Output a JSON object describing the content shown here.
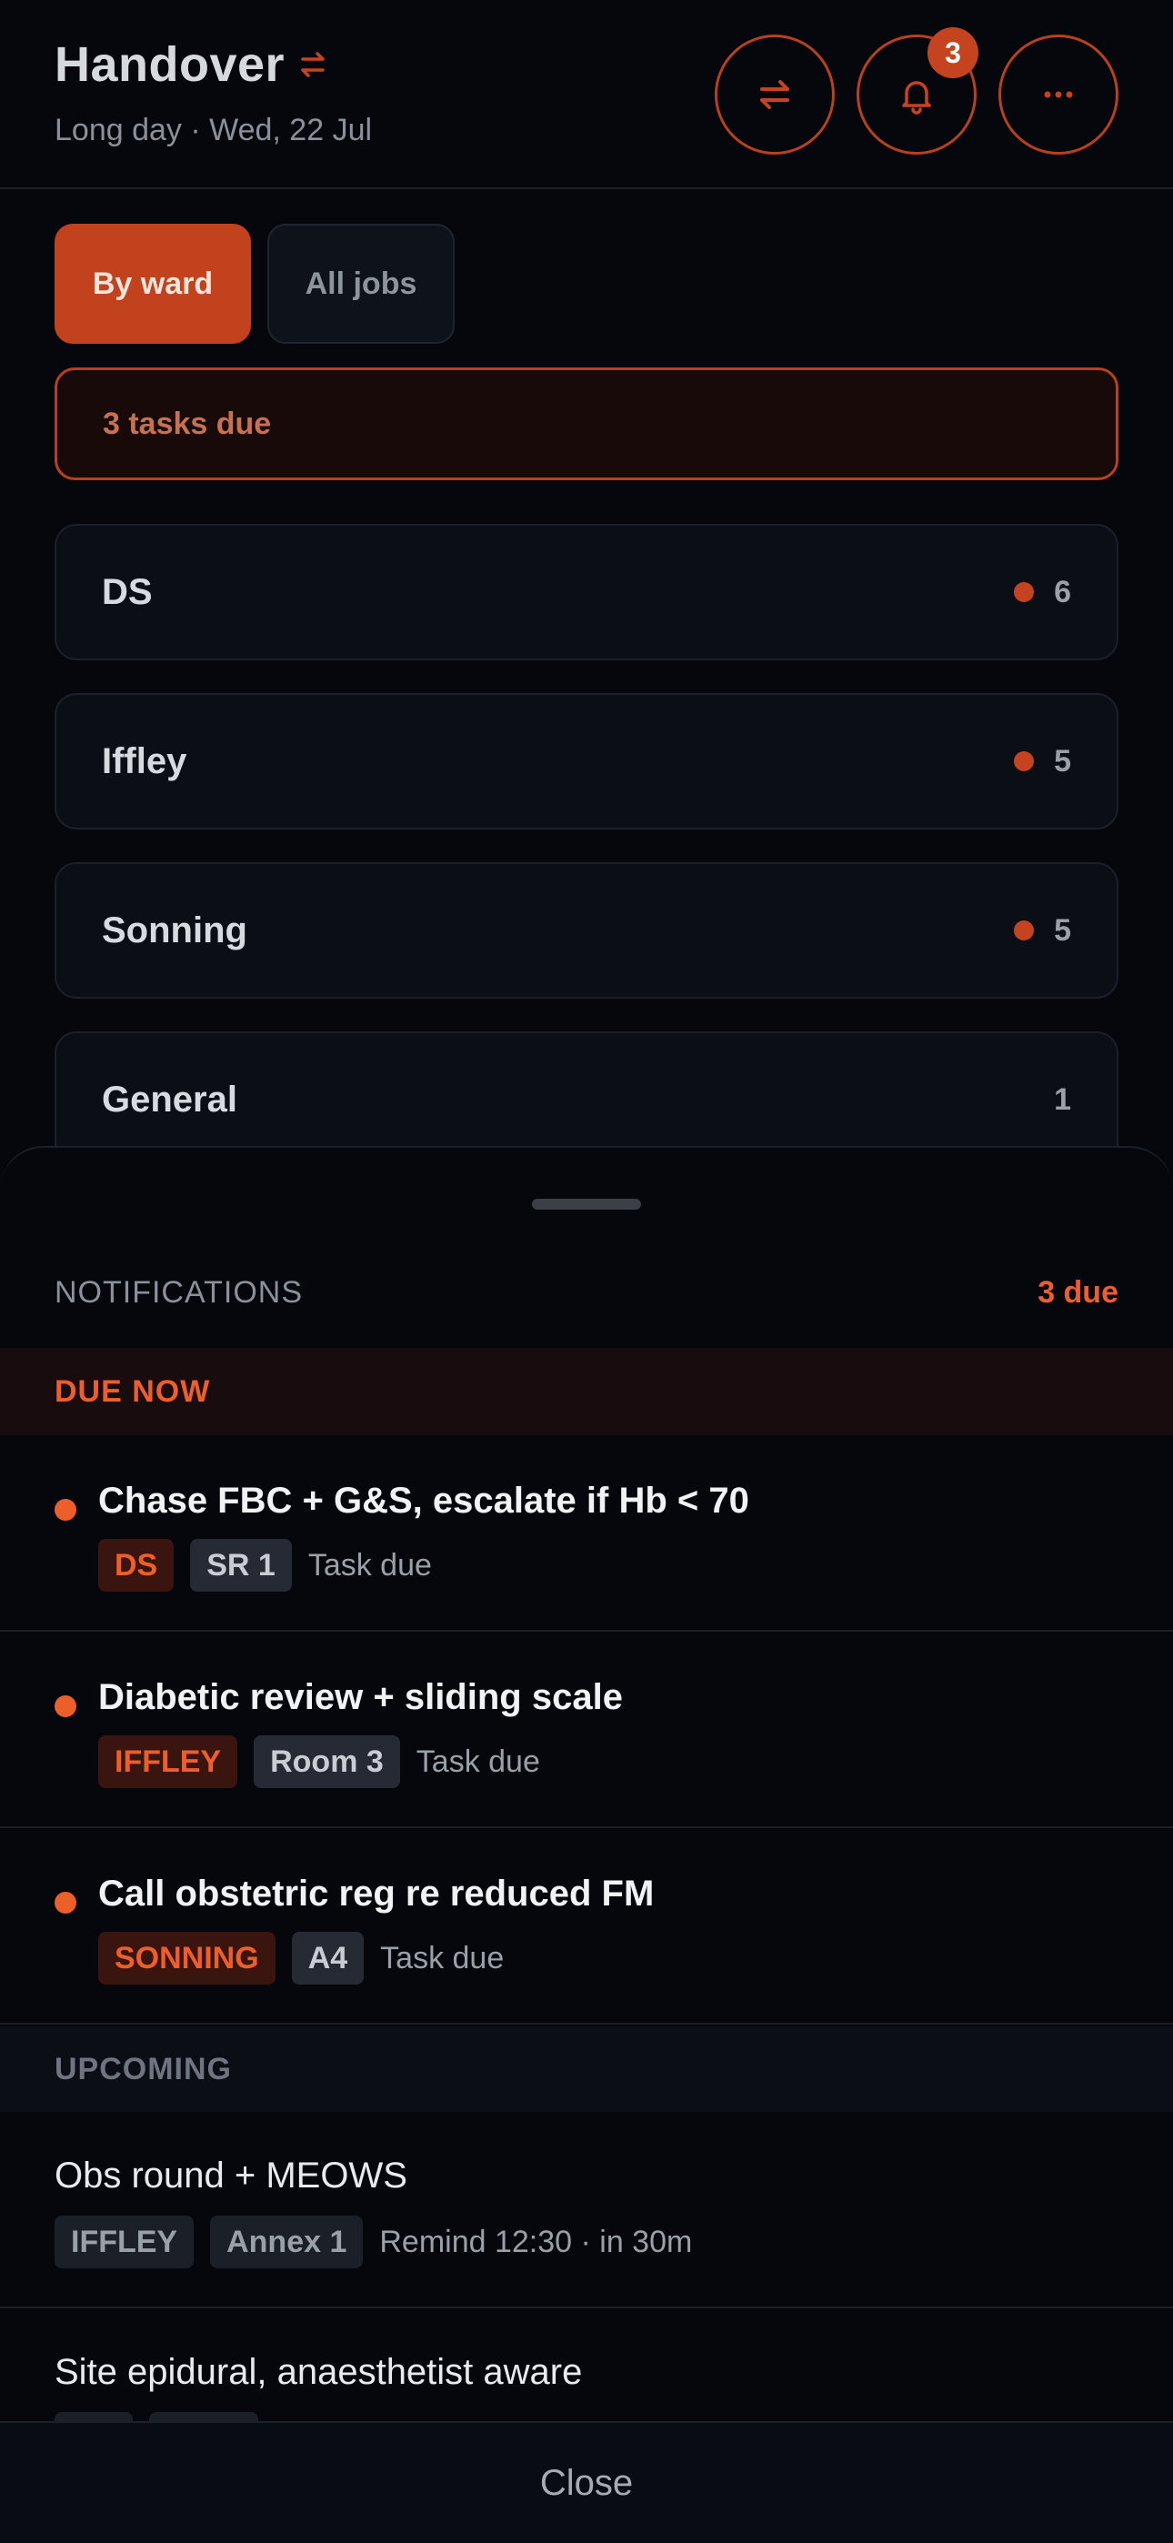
{
  "header": {
    "title": "Handover",
    "subtitle": "Long day · Wed, 22 Jul",
    "notification_count": "3"
  },
  "tabs": [
    {
      "label": "By ward",
      "active": true
    },
    {
      "label": "All jobs",
      "active": false
    }
  ],
  "due_banner": "3 tasks due",
  "wards": [
    {
      "name": "DS",
      "count": "6",
      "has_due": true
    },
    {
      "name": "Iffley",
      "count": "5",
      "has_due": true
    },
    {
      "name": "Sonning",
      "count": "5",
      "has_due": true
    },
    {
      "name": "General",
      "count": "1",
      "has_due": false
    }
  ],
  "sheet": {
    "title": "NOTIFICATIONS",
    "due_summary": "3 due",
    "due_section": "DUE NOW",
    "upcoming_section": "UPCOMING",
    "due_items": [
      {
        "title": "Chase FBC + G&S, escalate if Hb < 70",
        "ward": "DS",
        "room": "SR 1",
        "status": "Task due"
      },
      {
        "title": "Diabetic review + sliding scale",
        "ward": "IFFLEY",
        "room": "Room 3",
        "status": "Task due"
      },
      {
        "title": "Call obstetric reg re reduced FM",
        "ward": "SONNING",
        "room": "A4",
        "status": "Task due"
      }
    ],
    "upcoming_items": [
      {
        "title": "Obs round + MEOWS",
        "ward": "IFFLEY",
        "room": "Annex 1",
        "status": "Remind 12:30 · in 30m"
      },
      {
        "title": "Site epidural, anaesthetist aware",
        "ward": "",
        "room": "",
        "status": ""
      }
    ],
    "close_label": "Close"
  },
  "colors": {
    "accent": "#c5431e",
    "accent_bright": "#ec5f2b",
    "background": "#05070c"
  },
  "icons": {
    "swap": "swap-arrows-icon",
    "bell": "bell-icon",
    "more": "more-dots-icon"
  }
}
